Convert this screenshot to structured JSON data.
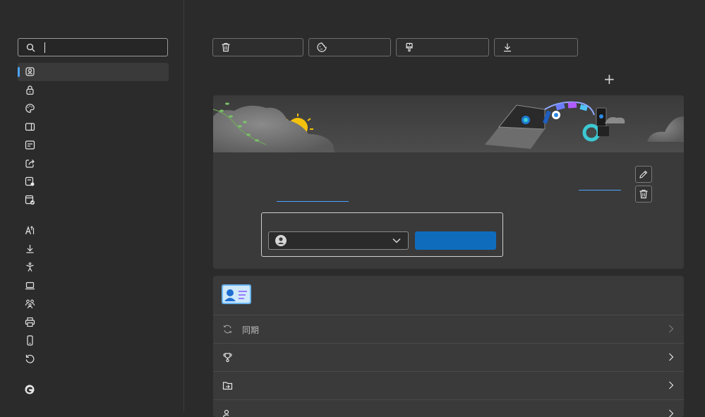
{
  "sidebar": {
    "search": {
      "value": "",
      "placeholder": ""
    },
    "items": [
      {
        "icon": "profile-icon",
        "label": ""
      },
      {
        "icon": "lock-icon",
        "label": ""
      },
      {
        "icon": "palette-icon",
        "label": ""
      },
      {
        "icon": "sidebar-panel-icon",
        "label": ""
      },
      {
        "icon": "new-tab-icon",
        "label": ""
      },
      {
        "icon": "share-icon",
        "label": ""
      },
      {
        "icon": "cookies-permissions-icon",
        "label": ""
      },
      {
        "icon": "default-browser-icon",
        "label": ""
      },
      {
        "icon": "languages-icon",
        "label": ""
      },
      {
        "icon": "downloads-icon",
        "label": ""
      },
      {
        "icon": "accessibility-icon",
        "label": ""
      },
      {
        "icon": "system-icon",
        "label": ""
      },
      {
        "icon": "family-icon",
        "label": ""
      },
      {
        "icon": "printer-icon",
        "label": ""
      },
      {
        "icon": "phone-icon",
        "label": ""
      },
      {
        "icon": "reset-icon",
        "label": ""
      }
    ]
  },
  "toolbar": {
    "clear_label": "",
    "cookies_label": "",
    "extensions_label": "",
    "downloads_label": ""
  },
  "add_profile_label": "+",
  "profile_card": {
    "account_link": "",
    "manage_link": "",
    "select_value": "",
    "signin_button": ""
  },
  "profile_settings": {
    "rows": [
      {
        "label": "同期"
      },
      {
        "label": ""
      },
      {
        "label": ""
      },
      {
        "label": ""
      }
    ]
  },
  "colors": {
    "accent": "#0f6cbd",
    "link": "#4da3ff",
    "background": "#2b2b2b",
    "card": "#3a3a3a"
  }
}
